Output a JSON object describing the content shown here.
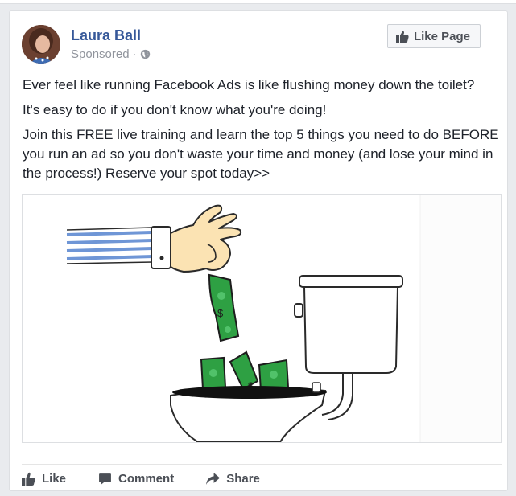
{
  "post": {
    "author": "Laura Ball",
    "sponsored_label": "Sponsored",
    "separator": "·",
    "like_page_label": "Like Page",
    "paragraphs": [
      "Ever feel like running Facebook Ads is like flushing money down the toilet?",
      "It's easy to do if you don't know what you're doing!",
      "Join this FREE live training and learn the top 5 things you need to do BEFORE you run an ad so you don't waste your time and money (and lose your mind in the process!) Reserve your spot today>>"
    ]
  },
  "actions": {
    "like": "Like",
    "comment": "Comment",
    "share": "Share"
  },
  "colors": {
    "author_link": "#365899",
    "money_green": "#2ea043",
    "sleeve_blue": "#6f96d6"
  },
  "icons": [
    "globe-icon",
    "thumbs-up-icon",
    "comment-icon",
    "share-icon"
  ]
}
